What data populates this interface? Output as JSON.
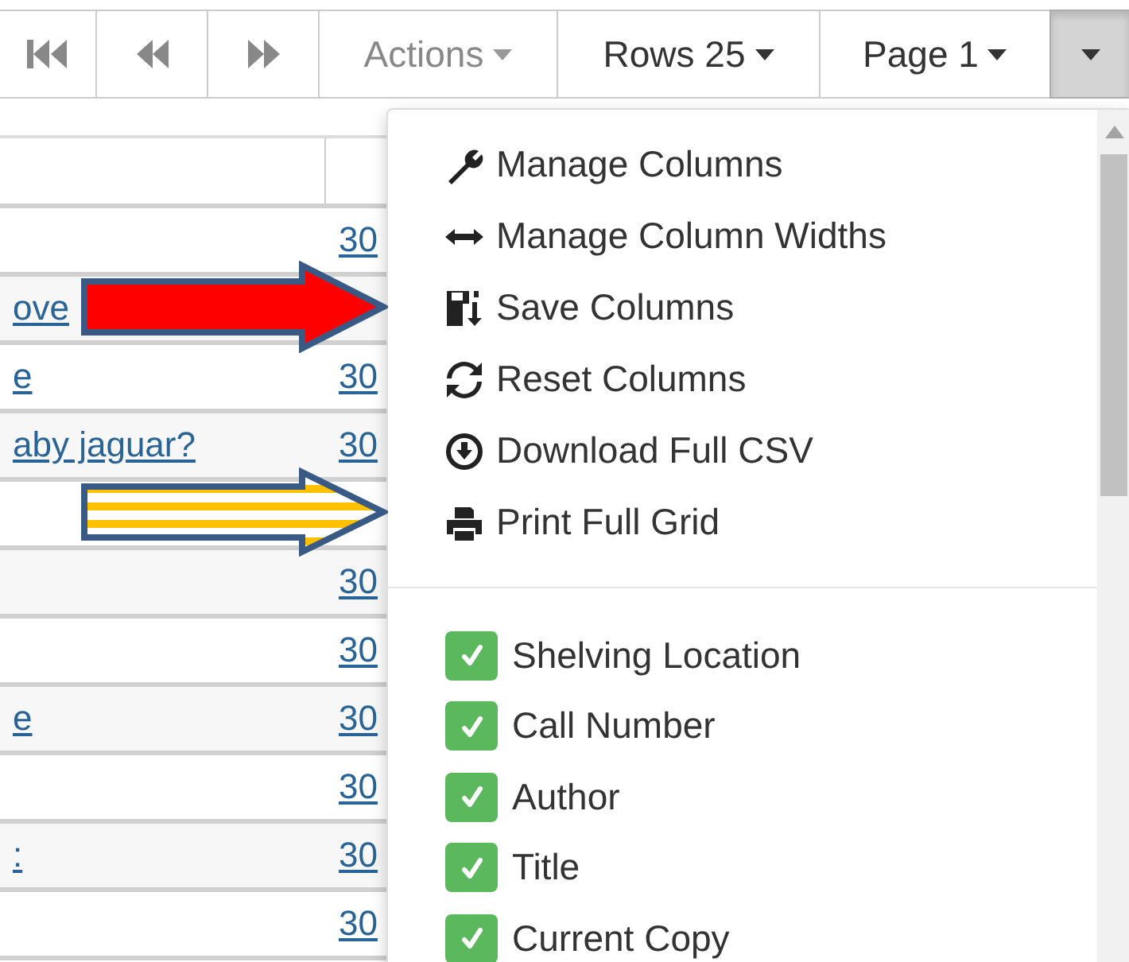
{
  "toolbar": [
    {
      "kind": "first"
    },
    {
      "kind": "previous"
    },
    {
      "kind": "next"
    },
    {
      "kind": "dropdown",
      "label": "Actions",
      "disabled": true,
      "active": false
    },
    {
      "kind": "dropdown",
      "label": "Rows 25",
      "disabled": false,
      "active": false
    },
    {
      "kind": "dropdown",
      "label": "Page 1",
      "disabled": false,
      "active": false
    },
    {
      "kind": "dropdown",
      "disabled": false,
      "active": true
    }
  ],
  "table": {
    "rows": [
      {
        "column_1": "",
        "column_2": "30"
      },
      {
        "column_1": "ove"
      },
      {
        "column_1": "e",
        "column_2": "30"
      },
      {
        "column_1": "aby jaguar?",
        "column_2": "30"
      },
      {
        "column_1": ""
      },
      {
        "column_1": "",
        "column_2": "30"
      },
      {
        "column_1": "",
        "column_2": "30"
      },
      {
        "column_1": "e",
        "column_2": "30"
      },
      {
        "column_1": "",
        "column_2": "30"
      },
      {
        "column_1": ":",
        "column_2": "30"
      },
      {
        "column_1": "",
        "column_2": "30"
      }
    ]
  },
  "menu": {
    "actions": [
      {
        "kind": "manage",
        "label": "Manage Columns"
      },
      {
        "kind": "widths",
        "label": "Manage Column Widths"
      },
      {
        "kind": "save",
        "label": "Save Columns"
      },
      {
        "kind": "reset",
        "label": "Reset Columns"
      },
      {
        "kind": "download",
        "label": "Download Full CSV"
      },
      {
        "kind": "print",
        "label": "Print Full Grid"
      }
    ],
    "columns": [
      {
        "label": "Shelving Location",
        "checked": true
      },
      {
        "label": "Call Number",
        "checked": true
      },
      {
        "label": "Author",
        "checked": true
      },
      {
        "label": "Title",
        "checked": true
      },
      {
        "label": "Current Copy",
        "checked": true
      }
    ]
  }
}
